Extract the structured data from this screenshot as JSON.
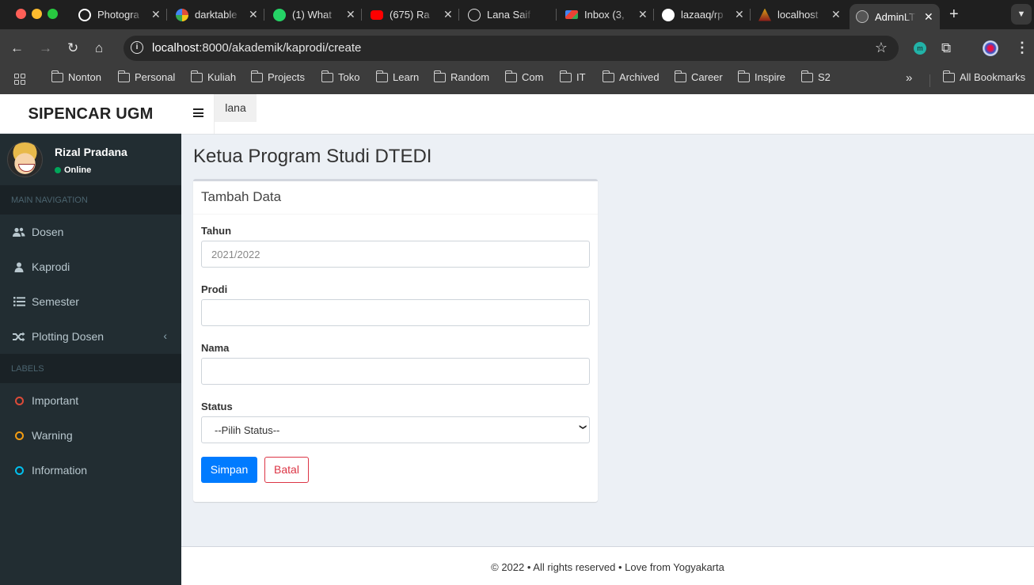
{
  "browser": {
    "tabs": [
      {
        "title": "Photogra",
        "icon": "chatgpt-icon",
        "color": "#ffffff"
      },
      {
        "title": "darktable",
        "icon": "darktable-icon",
        "color": "#e04d3a"
      },
      {
        "title": "(1) What",
        "icon": "whatsapp-icon",
        "color": "#25d366"
      },
      {
        "title": "(675) Ra",
        "icon": "youtube-icon",
        "color": "#ff0000"
      },
      {
        "title": "Lana Saif",
        "icon": "globe-icon",
        "color": "#e3e3e3"
      },
      {
        "title": "Inbox (3,",
        "icon": "gmail-icon",
        "color": "#ea4335"
      },
      {
        "title": "lazaaq/rp",
        "icon": "github-icon",
        "color": "#ffffff"
      },
      {
        "title": "localhost",
        "icon": "ugm-icon",
        "color": "#d4a017"
      },
      {
        "title": "AdminLT",
        "icon": "globe-icon",
        "color": "#bbbbbb"
      }
    ],
    "url_host": "localhost",
    "url_path": ":8000/akademik/kaprodi/create",
    "bookmarks": [
      "Nonton",
      "Personal",
      "Kuliah",
      "Projects",
      "Toko",
      "Learn",
      "Random",
      "Com",
      "IT",
      "Archived",
      "Career",
      "Inspire",
      "S2"
    ],
    "all_bookmarks": "All Bookmarks",
    "more": "»"
  },
  "app": {
    "brand": "SIPENCAR UGM",
    "top_user": "lana",
    "user": {
      "name": "Rizal Pradana",
      "status": "Online"
    },
    "sections": {
      "main": "MAIN NAVIGATION",
      "labels": "LABELS"
    },
    "menu": [
      {
        "label": "Dosen",
        "icon": "users-icon"
      },
      {
        "label": "Kaprodi",
        "icon": "user-icon"
      },
      {
        "label": "Semester",
        "icon": "list-icon"
      },
      {
        "label": "Plotting Dosen",
        "icon": "shuffle-icon"
      }
    ],
    "labels": [
      {
        "label": "Important",
        "color": "#dd4b39"
      },
      {
        "label": "Warning",
        "color": "#f39c12"
      },
      {
        "label": "Information",
        "color": "#00c0ef"
      }
    ],
    "page_title": "Ketua Program Studi DTEDI",
    "form": {
      "title": "Tambah Data",
      "tahun_label": "Tahun",
      "tahun_placeholder": "2021/2022",
      "prodi_label": "Prodi",
      "nama_label": "Nama",
      "status_label": "Status",
      "status_selected": "--Pilih Status--",
      "save": "Simpan",
      "cancel": "Batal"
    },
    "footer": "© 2022 • All rights reserved • Love from Yogyakarta"
  }
}
